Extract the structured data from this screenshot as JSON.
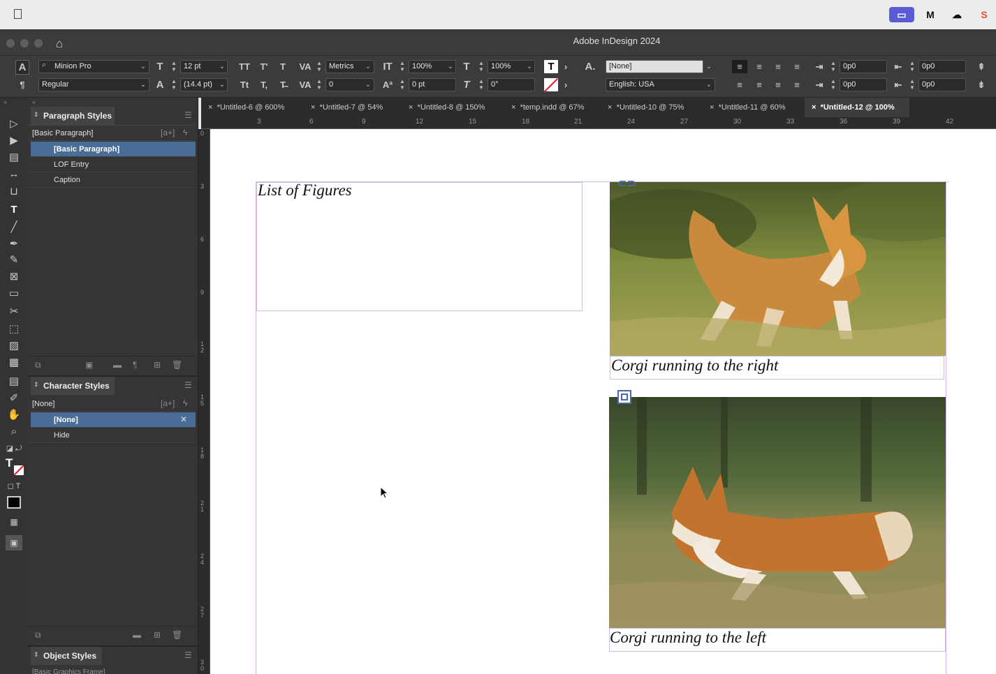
{
  "menubar": {
    "apple_icon": "apple-logo",
    "status_icons": [
      "display-icon",
      "m-app-icon",
      "creative-cloud-icon",
      "s-app-icon"
    ]
  },
  "window": {
    "title": "Adobe InDesign 2024"
  },
  "control_panel": {
    "font_family": "Minion Pro",
    "font_style": "Regular",
    "font_size": "12 pt",
    "leading": "(14.4 pt)",
    "kerning": "Metrics",
    "tracking": "0",
    "vertical_scale": "100%",
    "horizontal_scale": "100%",
    "baseline_shift": "0 pt",
    "skew": "0°",
    "char_style": "[None]",
    "language": "English: USA",
    "left_indent": "0p0",
    "right_indent": "0p0",
    "first_line_indent": "0p0",
    "last_line_indent": "0p0"
  },
  "paragraph_styles": {
    "title": "Paragraph Styles",
    "current": "[Basic Paragraph]",
    "items": [
      "[Basic Paragraph]",
      "LOF Entry",
      "Caption"
    ]
  },
  "character_styles": {
    "title": "Character Styles",
    "current": "[None]",
    "items": [
      "[None]",
      "Hide"
    ]
  },
  "object_styles": {
    "title": "Object Styles",
    "current": "[Basic Graphics Frame]"
  },
  "doc_tabs": [
    "*Untitled-6 @ 600%",
    "*Untitled-7 @ 54%",
    "*Untitled-8 @ 150%",
    "*temp.indd @ 67%",
    "*Untitled-10 @ 75%",
    "*Untitled-11 @ 60%",
    "*Untitled-12 @ 100%"
  ],
  "ruler": {
    "h": [
      "3",
      "6",
      "9",
      "12",
      "15",
      "18",
      "21",
      "24",
      "27",
      "30",
      "33",
      "36",
      "39",
      "42"
    ],
    "v": [
      "0",
      "3",
      "6",
      "9",
      "12",
      "15",
      "18",
      "21",
      "24",
      "27",
      "30"
    ]
  },
  "document": {
    "lof_title": "List of Figures",
    "caption1": "Corgi running to the right",
    "caption2": "Corgi running to the left"
  },
  "colors": {
    "selection": "#4a6d98",
    "frame_border": "#b9c4e6",
    "panel_bg": "#353535"
  }
}
